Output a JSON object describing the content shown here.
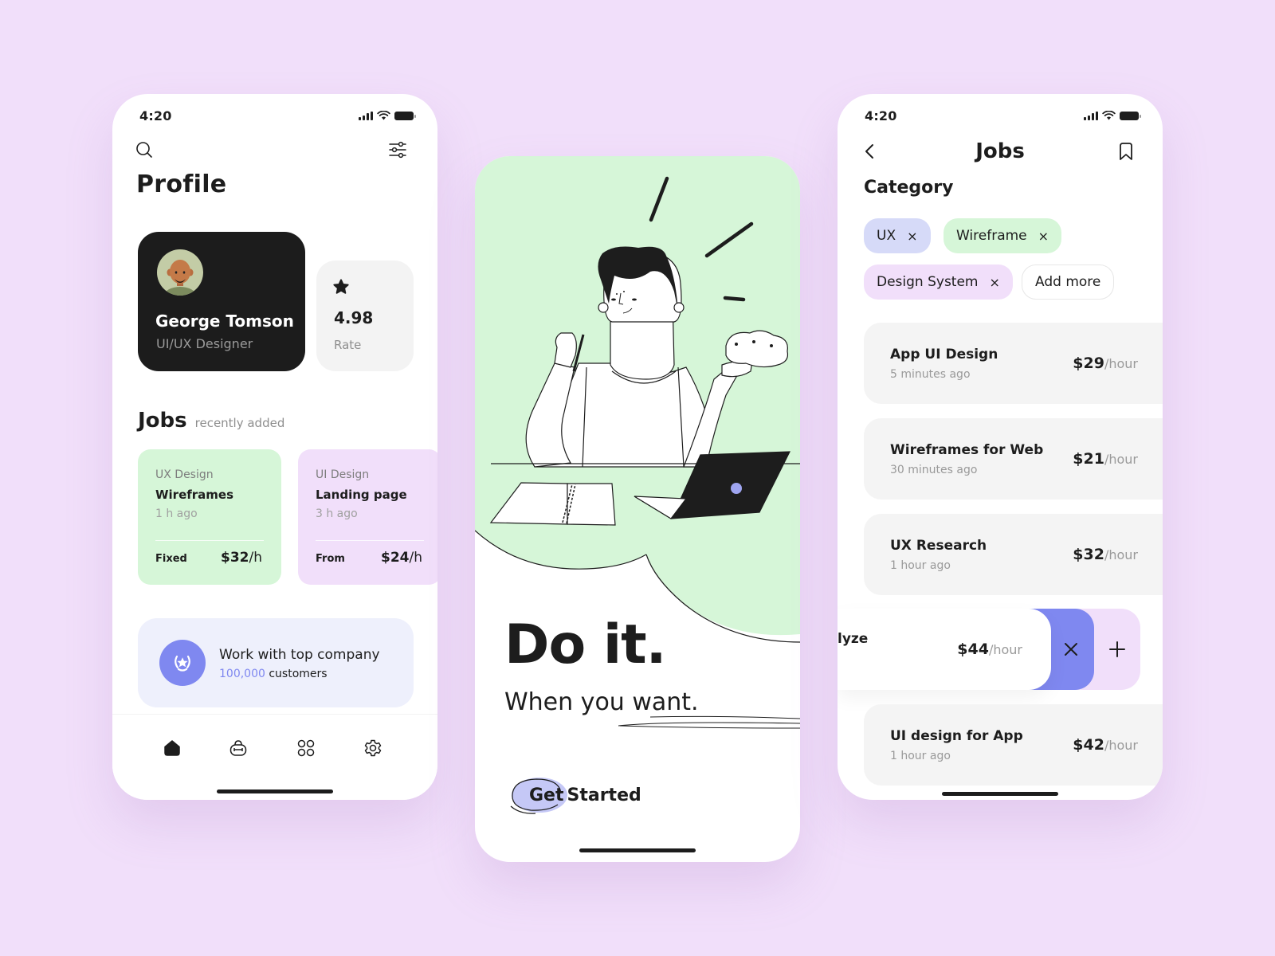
{
  "colors": {
    "background": "#f1dffa",
    "dark": "#1c1c1c",
    "accent": "#7f88f0",
    "green": "#d6f6d8",
    "lavender": "#f1dffa",
    "periwinkle": "#d6daf8"
  },
  "profile_screen": {
    "status": {
      "time": "4:20"
    },
    "header": {
      "search_icon": "search-icon",
      "filter_icon": "sliders-icon"
    },
    "title": "Profile",
    "user": {
      "name": "George Tomson",
      "role": "UI/UX Designer",
      "avatar": "avatar-3d-man"
    },
    "rating": {
      "value": "4.98",
      "label": "Rate",
      "icon": "star-icon"
    },
    "jobs": {
      "heading": "Jobs",
      "subheading": "recently added",
      "cards": [
        {
          "category": "UX Design",
          "title": "Wireframes",
          "time": "1 h ago",
          "type": "Fixed",
          "price": "$32",
          "unit": "/h",
          "color": "green"
        },
        {
          "category": "UI Design",
          "title": "Landing page",
          "time": "3 h ago",
          "type": "From",
          "price": "$24",
          "unit": "/h",
          "color": "purple"
        }
      ]
    },
    "promo": {
      "title": "Work with top company",
      "count": "100,000",
      "suffix": " customers",
      "icon": "laurel-star-icon"
    },
    "tabbar": [
      "home-icon",
      "briefcase-icon",
      "grid-icon",
      "settings-icon"
    ],
    "active_tab": "home"
  },
  "intro_screen": {
    "headline": "Do it.",
    "subline": "When you want.",
    "cta": {
      "word1": "Get",
      "word2": "Started"
    },
    "illustration": "man-at-desk-with-laptop-and-notebook"
  },
  "jobs_screen": {
    "status": {
      "time": "4:20"
    },
    "nav": {
      "title": "Jobs",
      "back_icon": "chevron-left-icon",
      "bookmark_icon": "bookmark-icon"
    },
    "category_title": "Category",
    "chips": [
      {
        "label": "UX",
        "removable": true
      },
      {
        "label": "Wireframe",
        "removable": true
      },
      {
        "label": "Design System",
        "removable": true
      }
    ],
    "add_more": "Add more",
    "remove_glyph": "×",
    "list": [
      {
        "title": "App UI Design",
        "time": "5 minutes ago",
        "price": "$29",
        "unit": "/hour"
      },
      {
        "title": "Wireframes for Web",
        "time": "30 minutes ago",
        "price": "$21",
        "unit": "/hour"
      },
      {
        "title": "UX Research",
        "time": "1 hour ago",
        "price": "$32",
        "unit": "/hour"
      }
    ],
    "swiped_item": {
      "title_visible": "lyze",
      "price": "$44",
      "unit": "/hour",
      "delete_glyph": "×",
      "add_glyph": "+"
    },
    "last_item": {
      "title": "UI design for App",
      "time": "1 hour ago",
      "price": "$42",
      "unit": "/hour"
    }
  }
}
